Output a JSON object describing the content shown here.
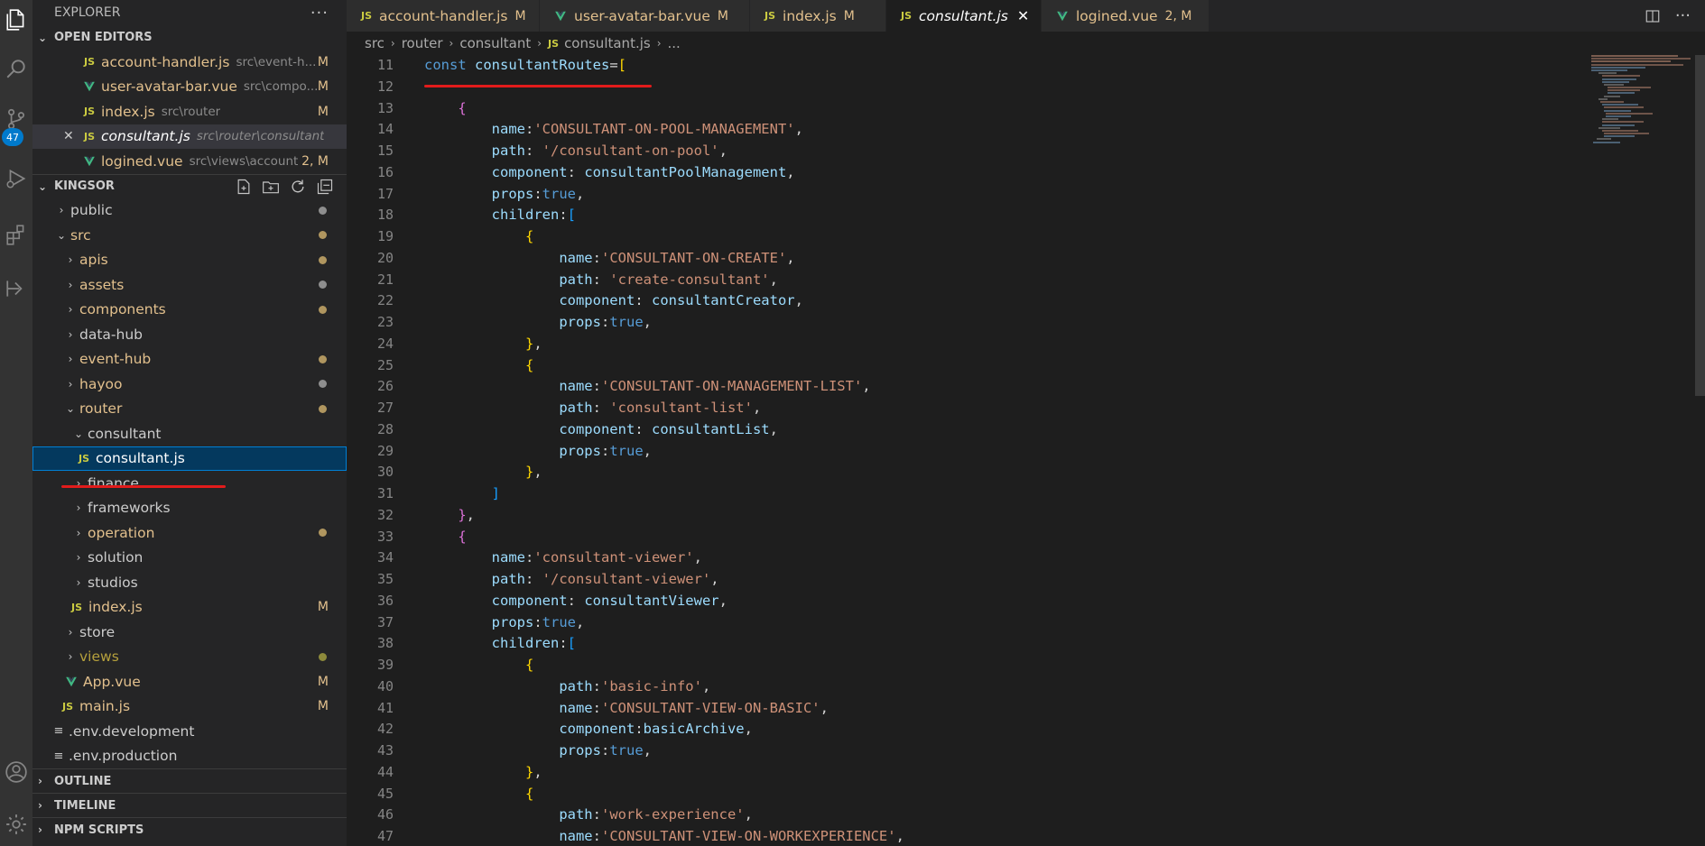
{
  "activity_bar": {
    "icons": [
      "files-icon",
      "search-icon",
      "source-control-icon",
      "run-debug-icon",
      "extensions-icon",
      "remote-icon",
      "account-icon",
      "settings-icon"
    ],
    "scm_badge": "47"
  },
  "sidebar": {
    "title": "EXPLORER",
    "more": "···",
    "open_editors": {
      "label": "OPEN EDITORS",
      "items": [
        {
          "name": "account-handler.js",
          "desc": "src\\event-h...",
          "status": "M",
          "type": "js"
        },
        {
          "name": "user-avatar-bar.vue",
          "desc": "src\\compo...",
          "status": "M",
          "type": "vue"
        },
        {
          "name": "index.js",
          "desc": "src\\router",
          "status": "M",
          "type": "js"
        },
        {
          "name": "consultant.js",
          "desc": "src\\router\\consultant",
          "status": "",
          "type": "js"
        },
        {
          "name": "logined.vue",
          "desc": "src\\views\\account",
          "status": "2, M",
          "type": "vue"
        }
      ]
    },
    "project": {
      "label": "KINGSOR",
      "tree": [
        {
          "name": "public",
          "chev": "›"
        },
        {
          "name": "src",
          "chev": "⌄"
        },
        {
          "name": "apis",
          "chev": "›"
        },
        {
          "name": "assets",
          "chev": "›"
        },
        {
          "name": "components",
          "chev": "›"
        },
        {
          "name": "data-hub",
          "chev": "›"
        },
        {
          "name": "event-hub",
          "chev": "›"
        },
        {
          "name": "hayoo",
          "chev": "›"
        },
        {
          "name": "router",
          "chev": "⌄"
        },
        {
          "name": "consultant",
          "chev": "⌄"
        },
        {
          "name": "consultant.js"
        },
        {
          "name": "finance",
          "chev": "›"
        },
        {
          "name": "frameworks",
          "chev": "›"
        },
        {
          "name": "operation",
          "chev": "›"
        },
        {
          "name": "solution",
          "chev": "›"
        },
        {
          "name": "studios",
          "chev": "›"
        },
        {
          "name": "index.js",
          "status": "M"
        },
        {
          "name": "store",
          "chev": "›"
        },
        {
          "name": "views",
          "chev": "›"
        },
        {
          "name": "App.vue",
          "status": "M"
        },
        {
          "name": "main.js",
          "status": "M"
        },
        {
          "name": ".env.development"
        },
        {
          "name": ".env.production"
        }
      ]
    },
    "sections": [
      "OUTLINE",
      "TIMELINE",
      "NPM SCRIPTS"
    ]
  },
  "tabs": [
    {
      "name": "account-handler.js",
      "status": "M",
      "type": "js"
    },
    {
      "name": "user-avatar-bar.vue",
      "status": "M",
      "type": "vue"
    },
    {
      "name": "index.js",
      "status": "M",
      "type": "js"
    },
    {
      "name": "consultant.js",
      "status": "",
      "type": "js",
      "active": true
    },
    {
      "name": "logined.vue",
      "status": "2, M",
      "type": "vue"
    }
  ],
  "breadcrumb": [
    "src",
    "router",
    "consultant",
    "consultant.js",
    "..."
  ],
  "editor": {
    "line_numbers": [
      "11",
      "12",
      "13",
      "14",
      "15",
      "16",
      "17",
      "18",
      "19",
      "20",
      "21",
      "22",
      "23",
      "24",
      "25",
      "26",
      "27",
      "28",
      "29",
      "30",
      "31",
      "32",
      "33",
      "34",
      "35",
      "36",
      "37",
      "38",
      "39",
      "40",
      "41",
      "42",
      "43",
      "44",
      "45",
      "46",
      "47"
    ]
  },
  "colors": {
    "keyword": "#569cd6",
    "variable": "#9cdcfe",
    "string": "#ce9178",
    "modified": "#e2c08d",
    "annotation_red": "#e21b1b",
    "accent": "#007acc"
  }
}
